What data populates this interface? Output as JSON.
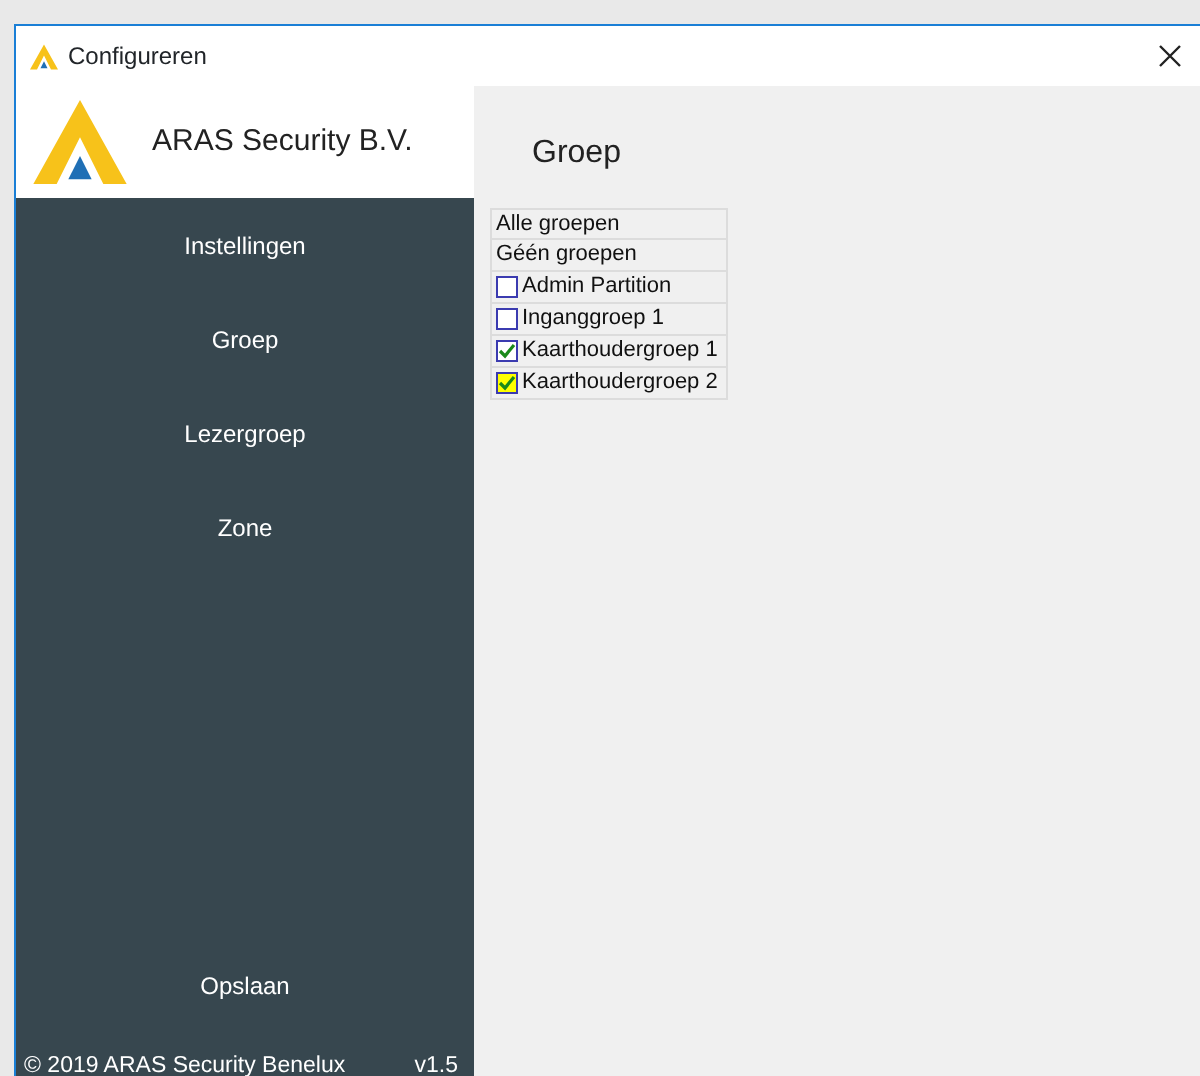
{
  "window": {
    "title": "Configureren"
  },
  "sidebar": {
    "brand": "ARAS Security B.V.",
    "items": [
      {
        "label": "Instellingen"
      },
      {
        "label": "Groep"
      },
      {
        "label": "Lezergroep"
      },
      {
        "label": "Zone"
      }
    ],
    "save": "Opslaan",
    "footer": {
      "copyright": "© 2019 ARAS Security Benelux",
      "version": "v1.5"
    }
  },
  "content": {
    "heading": "Groep",
    "actions": [
      "Alle groepen",
      "Géén groepen"
    ],
    "groups": [
      {
        "label": "Admin Partition",
        "checked": false,
        "highlighted": false
      },
      {
        "label": "Inganggroep 1",
        "checked": false,
        "highlighted": false
      },
      {
        "label": "Kaarthoudergroep 1",
        "checked": true,
        "highlighted": false
      },
      {
        "label": "Kaarthoudergroep 2",
        "checked": true,
        "highlighted": true
      }
    ]
  }
}
